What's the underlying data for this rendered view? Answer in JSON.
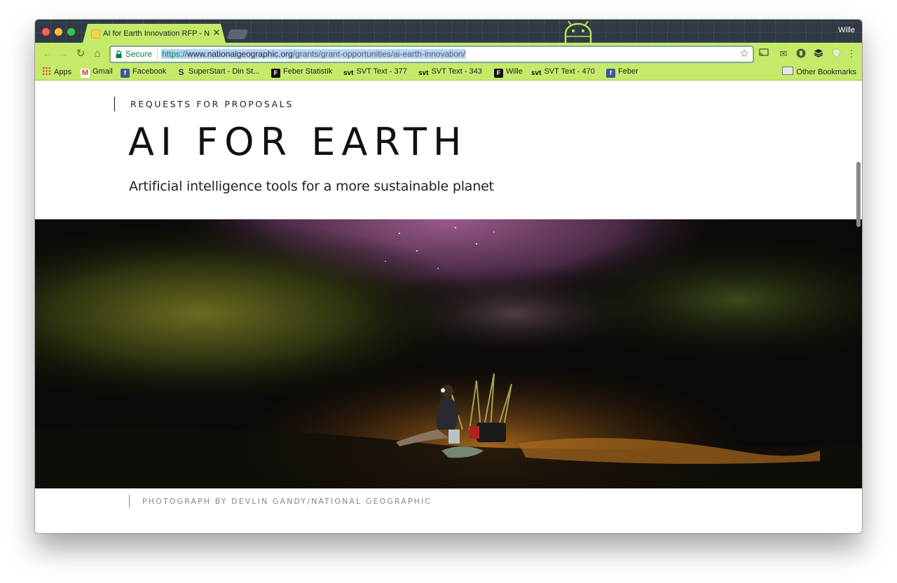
{
  "browser": {
    "tab": {
      "title": "AI for Earth Innovation RFP - N",
      "close": "✕"
    },
    "profile_name": "Wille",
    "omnibox": {
      "secure_label": "Secure",
      "url_scheme": "https://",
      "url_host": "www.nationalgeographic.org",
      "url_path": "/grants/grant-opportunities/ai-earth-innovation/"
    },
    "bookmarks": [
      {
        "label": "Apps",
        "icon": "apps-grid-icon"
      },
      {
        "label": "Gmail",
        "icon": "gmail-icon"
      },
      {
        "label": "Facebook",
        "icon": "facebook-icon"
      },
      {
        "label": "SuperStart - Din St...",
        "icon": "superstart-icon"
      },
      {
        "label": "Feber Statistik",
        "icon": "feber-icon"
      },
      {
        "label": "SVT Text - 377",
        "icon": "svt-icon"
      },
      {
        "label": "SVT Text - 343",
        "icon": "svt-icon"
      },
      {
        "label": "Wille",
        "icon": "feber-icon"
      },
      {
        "label": "SVT Text - 470",
        "icon": "svt-icon"
      },
      {
        "label": "Feber",
        "icon": "facebook-icon"
      }
    ],
    "other_bookmarks": "Other Bookmarks",
    "icon_glyphs": {
      "svt": "svt",
      "gmail": "M",
      "facebook": "f",
      "superstart": "S",
      "feber": "F"
    }
  },
  "page": {
    "eyebrow": "REQUESTS FOR PROPOSALS",
    "title": "AI FOR EARTH",
    "subtitle": "Artificial intelligence tools for a more sustainable planet",
    "photo_credit": "PHOTOGRAPH BY DEVLIN GANDY/NATIONAL GEOGRAPHIC"
  },
  "colors": {
    "theme_green": "#c5ea6a",
    "titlebar_dark": "#2f3a44",
    "secure_green": "#0b8043"
  }
}
